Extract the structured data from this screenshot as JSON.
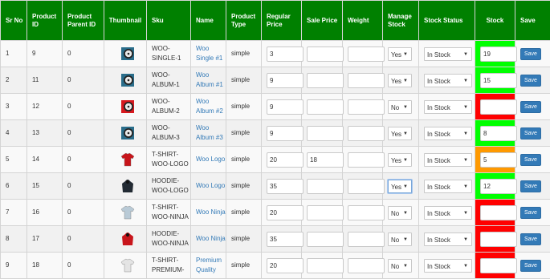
{
  "columns": [
    "Sr No",
    "Product ID",
    "Product Parent ID",
    "Thumbnail",
    "Sku",
    "Name",
    "Product Type",
    "Regular Price",
    "Sale Price",
    "Weight",
    "Manage Stock",
    "Stock Status",
    "Stock",
    "Save"
  ],
  "save_label": "Save",
  "rows": [
    {
      "sr": "1",
      "id": "9",
      "parent": "0",
      "sku": "WOO-SINGLE-1",
      "name": "Woo Single #1",
      "type": "simple",
      "regular": "3",
      "sale": "",
      "weight": "",
      "manage": "Yes",
      "status": "In Stock",
      "stock": "19",
      "stock_color": "#00ff00",
      "thumb": "cd"
    },
    {
      "sr": "2",
      "id": "11",
      "parent": "0",
      "sku": "WOO-ALBUM-1",
      "name": "Woo Album #1",
      "type": "simple",
      "regular": "9",
      "sale": "",
      "weight": "",
      "manage": "Yes",
      "status": "In Stock",
      "stock": "15",
      "stock_color": "#00ff00",
      "thumb": "cd"
    },
    {
      "sr": "3",
      "id": "12",
      "parent": "0",
      "sku": "WOO-ALBUM-2",
      "name": "Woo Album #2",
      "type": "simple",
      "regular": "9",
      "sale": "",
      "weight": "",
      "manage": "No",
      "status": "In Stock",
      "stock": "",
      "stock_color": "#ff0000",
      "thumb": "cd-red"
    },
    {
      "sr": "4",
      "id": "13",
      "parent": "0",
      "sku": "WOO-ALBUM-3",
      "name": "Woo Album #3",
      "type": "simple",
      "regular": "9",
      "sale": "",
      "weight": "",
      "manage": "Yes",
      "status": "In Stock",
      "stock": "8",
      "stock_color": "#00ff00",
      "thumb": "cd"
    },
    {
      "sr": "5",
      "id": "14",
      "parent": "0",
      "sku": "T-SHIRT-WOO-LOGO",
      "name": "Woo Logo",
      "type": "simple",
      "regular": "20",
      "sale": "18",
      "weight": "",
      "manage": "Yes",
      "status": "In Stock",
      "stock": "5",
      "stock_color": "#ff9900",
      "thumb": "tshirt-red"
    },
    {
      "sr": "6",
      "id": "15",
      "parent": "0",
      "sku": "HOODIE-WOO-LOGO",
      "name": "Woo Logo",
      "type": "simple",
      "regular": "35",
      "sale": "",
      "weight": "",
      "manage": "Yes",
      "status": "In Stock",
      "stock": "12",
      "stock_color": "#00ff00",
      "thumb": "hoodie-black",
      "focus": true
    },
    {
      "sr": "7",
      "id": "16",
      "parent": "0",
      "sku": "T-SHIRT-WOO-NINJA",
      "name": "Woo Ninja",
      "type": "simple",
      "regular": "20",
      "sale": "",
      "weight": "",
      "manage": "No",
      "status": "In Stock",
      "stock": "",
      "stock_color": "#ff0000",
      "thumb": "tshirt-grey"
    },
    {
      "sr": "8",
      "id": "17",
      "parent": "0",
      "sku": "HOODIE-WOO-NINJA",
      "name": "Woo Ninja",
      "type": "simple",
      "regular": "35",
      "sale": "",
      "weight": "",
      "manage": "No",
      "status": "In Stock",
      "stock": "",
      "stock_color": "#ff0000",
      "thumb": "hoodie-red"
    },
    {
      "sr": "9",
      "id": "18",
      "parent": "0",
      "sku": "T-SHIRT-PREMIUM-",
      "name": "Premium Quality",
      "type": "simple",
      "regular": "20",
      "sale": "",
      "weight": "",
      "manage": "No",
      "status": "In Stock",
      "stock": "",
      "stock_color": "#ff0000",
      "thumb": "tshirt-white"
    }
  ]
}
